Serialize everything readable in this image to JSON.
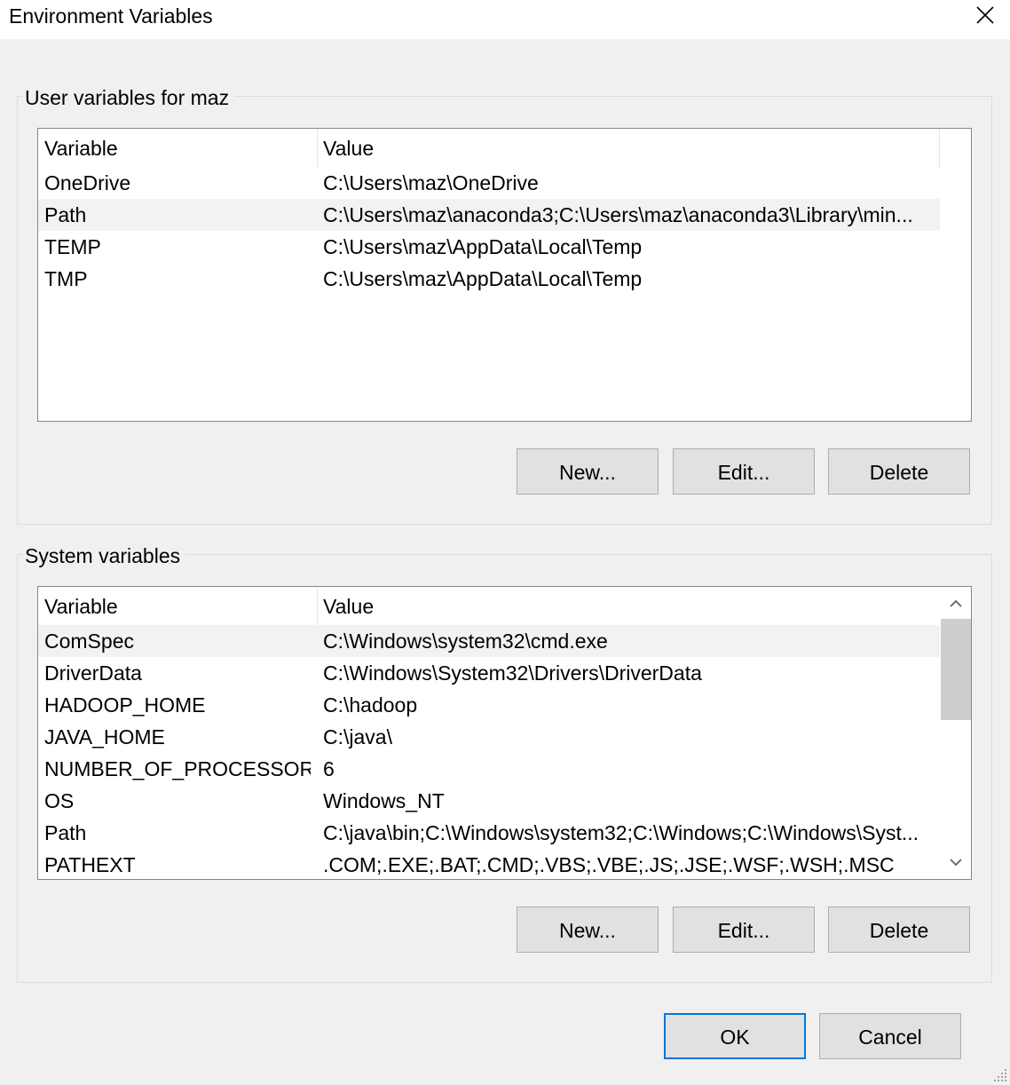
{
  "window": {
    "title": "Environment Variables"
  },
  "user_group": {
    "label": "User variables for maz",
    "columns": [
      "Variable",
      "Value"
    ],
    "rows": [
      {
        "name": "OneDrive",
        "value": "C:\\Users\\maz\\OneDrive"
      },
      {
        "name": "Path",
        "value": "C:\\Users\\maz\\anaconda3;C:\\Users\\maz\\anaconda3\\Library\\min..."
      },
      {
        "name": "TEMP",
        "value": "C:\\Users\\maz\\AppData\\Local\\Temp"
      },
      {
        "name": "TMP",
        "value": "C:\\Users\\maz\\AppData\\Local\\Temp"
      }
    ],
    "selected_row": "Path",
    "buttons": {
      "new": "New...",
      "edit": "Edit...",
      "delete": "Delete"
    }
  },
  "system_group": {
    "label": "System variables",
    "columns": [
      "Variable",
      "Value"
    ],
    "rows": [
      {
        "name": "ComSpec",
        "value": "C:\\Windows\\system32\\cmd.exe"
      },
      {
        "name": "DriverData",
        "value": "C:\\Windows\\System32\\Drivers\\DriverData"
      },
      {
        "name": "HADOOP_HOME",
        "value": "C:\\hadoop"
      },
      {
        "name": "JAVA_HOME",
        "value": "C:\\java\\"
      },
      {
        "name": "NUMBER_OF_PROCESSORS",
        "value": "6"
      },
      {
        "name": "OS",
        "value": "Windows_NT"
      },
      {
        "name": "Path",
        "value": "C:\\java\\bin;C:\\Windows\\system32;C:\\Windows;C:\\Windows\\Syst..."
      },
      {
        "name": "PATHEXT",
        "value": ".COM;.EXE;.BAT;.CMD;.VBS;.VBE;.JS;.JSE;.WSF;.WSH;.MSC"
      }
    ],
    "selected_row": "ComSpec",
    "buttons": {
      "new": "New...",
      "edit": "Edit...",
      "delete": "Delete"
    }
  },
  "footer": {
    "ok": "OK",
    "cancel": "Cancel"
  },
  "colors": {
    "accent": "#0078d7",
    "button_face": "#e1e1e1",
    "selection": "#f2f2f2"
  }
}
